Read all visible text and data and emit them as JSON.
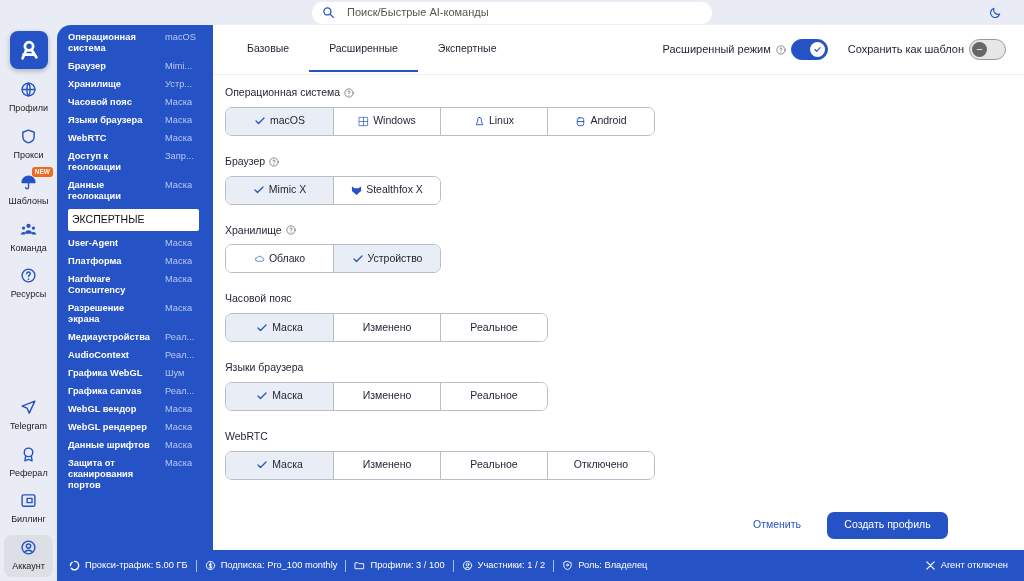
{
  "search": {
    "placeholder": "Поиск/Быстрые AI-команды"
  },
  "rail": {
    "items": [
      {
        "label": "Профили",
        "selected": false
      },
      {
        "label": "Прокси",
        "selected": false
      },
      {
        "label": "Шаблоны",
        "selected": false,
        "badge": "NEW"
      },
      {
        "label": "Команда",
        "selected": false
      },
      {
        "label": "Ресурсы",
        "selected": false
      }
    ],
    "bottom_items": [
      {
        "label": "Telegram",
        "selected": false
      },
      {
        "label": "Реферал",
        "selected": false
      },
      {
        "label": "Биллинг",
        "selected": false
      },
      {
        "label": "Аккаунт",
        "selected": true
      }
    ]
  },
  "summary": [
    {
      "kind": "item",
      "name": "Операционная система",
      "value": "macOS"
    },
    {
      "kind": "item",
      "name": "Браузер",
      "value": "Mimi..."
    },
    {
      "kind": "item",
      "name": "Хранилище",
      "value": "Устр..."
    },
    {
      "kind": "item",
      "name": "Часовой пояс",
      "value": "Маска"
    },
    {
      "kind": "item",
      "name": "Языки браузера",
      "value": "Маска"
    },
    {
      "kind": "item",
      "name": "WebRTC",
      "value": "Маска"
    },
    {
      "kind": "item",
      "name": "Доступ к геолокации",
      "value": "Запр..."
    },
    {
      "kind": "item",
      "name": "Данные геолокации",
      "value": "Маска"
    },
    {
      "kind": "heading",
      "name": "ЭКСПЕРТНЫЕ"
    },
    {
      "kind": "item",
      "name": "User-Agent",
      "value": "Маска"
    },
    {
      "kind": "item",
      "name": "Платформа",
      "value": "Маска"
    },
    {
      "kind": "item",
      "name": "Hardware Concurrency",
      "value": "Маска"
    },
    {
      "kind": "item",
      "name": "Разрешение экрана",
      "value": "Маска"
    },
    {
      "kind": "item",
      "name": "Медиаустройства",
      "value": "Реал..."
    },
    {
      "kind": "item",
      "name": "AudioContext",
      "value": "Реал..."
    },
    {
      "kind": "item",
      "name": "Графика WebGL",
      "value": "Шум"
    },
    {
      "kind": "item",
      "name": "Графика canvas",
      "value": "Реал..."
    },
    {
      "kind": "item",
      "name": "WebGL вендор",
      "value": "Маска"
    },
    {
      "kind": "item",
      "name": "WebGL рендерер",
      "value": "Маска"
    },
    {
      "kind": "item",
      "name": "Данные шрифтов",
      "value": "Маска"
    },
    {
      "kind": "item",
      "name": "Защита от сканирования портов",
      "value": "Маска"
    }
  ],
  "tabs": [
    {
      "label": "Базовые",
      "selected": false
    },
    {
      "label": "Расширенные",
      "selected": true
    },
    {
      "label": "Экспертные",
      "selected": false
    }
  ],
  "toggles": [
    {
      "label": "Расширенный режим",
      "help": true,
      "on": true
    },
    {
      "label": "Сохранить как шаблон",
      "help": false,
      "on": false
    }
  ],
  "sections": [
    {
      "label": "Операционная система",
      "help": true,
      "options": [
        {
          "label": "macOS",
          "selected": true
        },
        {
          "label": "Windows",
          "selected": false
        },
        {
          "label": "Linux",
          "selected": false
        },
        {
          "label": "Android",
          "selected": false
        }
      ]
    },
    {
      "label": "Браузер",
      "help": true,
      "options": [
        {
          "label": "Mimic X",
          "selected": true
        },
        {
          "label": "Stealthfox X",
          "selected": false
        }
      ]
    },
    {
      "label": "Хранилище",
      "help": true,
      "options": [
        {
          "label": "Облако",
          "selected": false
        },
        {
          "label": "Устройство",
          "selected": true
        }
      ]
    },
    {
      "label": "Часовой пояс",
      "help": false,
      "options": [
        {
          "label": "Маска",
          "selected": true
        },
        {
          "label": "Изменено",
          "selected": false
        },
        {
          "label": "Реальное",
          "selected": false
        }
      ]
    },
    {
      "label": "Языки браузера",
      "help": false,
      "options": [
        {
          "label": "Маска",
          "selected": true
        },
        {
          "label": "Изменено",
          "selected": false
        },
        {
          "label": "Реальное",
          "selected": false
        }
      ]
    },
    {
      "label": "WebRTC",
      "help": false,
      "options": [
        {
          "label": "Маска",
          "selected": true
        },
        {
          "label": "Изменено",
          "selected": false
        },
        {
          "label": "Реальное",
          "selected": false
        },
        {
          "label": "Отключено",
          "selected": false
        }
      ]
    }
  ],
  "footer": {
    "cancel": "Отменить",
    "create": "Создать профиль"
  },
  "status_bar": {
    "items": [
      "Прокси-трафик: 5.00 ГБ",
      "Подписка: Pro_100 monthly",
      "Профили: 3 / 100",
      "Участники: 1 / 2",
      "Роль: Владелец"
    ],
    "agent": "Агент отключен"
  }
}
